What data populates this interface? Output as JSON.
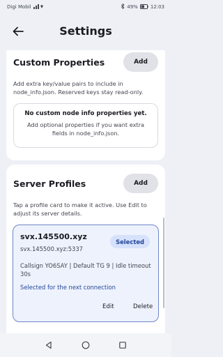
{
  "status_bar": {
    "carrier": "Digi Mobil",
    "battery": "49%",
    "time": "12:03"
  },
  "header": {
    "title": "Settings",
    "back_icon": "arrow-back-icon"
  },
  "custom_properties": {
    "title": "Custom Properties",
    "add_label": "Add",
    "description": "Add extra key/value pairs to include in node_info.json. Reserved keys stay read-only.",
    "empty_title": "No custom node info properties yet.",
    "empty_text": "Add optional properties if you want extra fields in node_info.json."
  },
  "server_profiles": {
    "title": "Server Profiles",
    "add_label": "Add",
    "description": "Tap a profile card to make it active. Use Edit to adjust its server details.",
    "profiles": [
      {
        "name": "svx.145500.xyz",
        "address": "svx.145500.xyz:5337",
        "badge": "Selected",
        "info": "Callsign YO6SAY | Default TG 9 | Idle timeout 30s",
        "status": "Selected for the next connection",
        "edit_label": "Edit",
        "delete_label": "Delete"
      }
    ]
  },
  "colors": {
    "background": "#eef0f6",
    "accent": "#22469a",
    "selected_border": "#6f86c9"
  },
  "nav_bar": {
    "back_icon": "nav-back-icon",
    "home_icon": "nav-home-icon",
    "recents_icon": "nav-recents-icon"
  }
}
